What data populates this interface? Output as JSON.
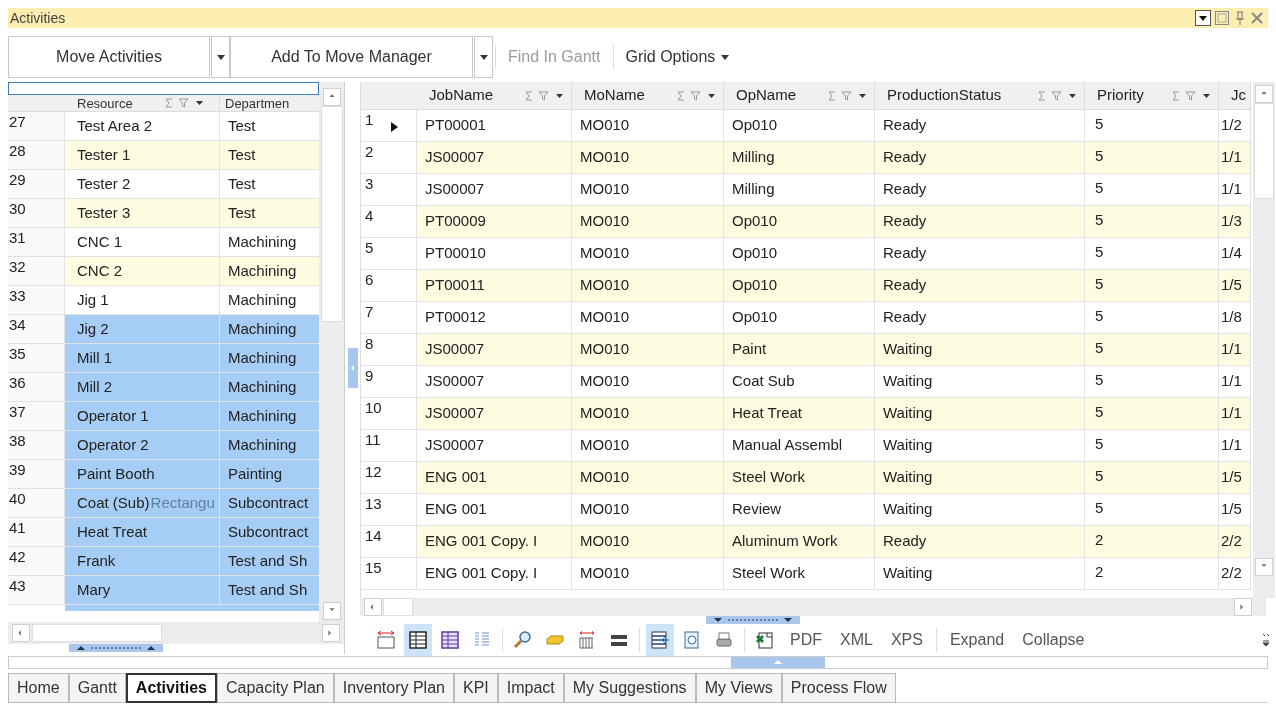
{
  "window": {
    "title": "Activities"
  },
  "toolbar": {
    "items": [
      {
        "kind": "split",
        "label": "Move Activities",
        "disabled": false
      },
      {
        "kind": "split",
        "label": "Add To Move Manager",
        "disabled": false
      },
      {
        "kind": "button",
        "label": "Find In Gantt",
        "disabled": true
      },
      {
        "kind": "menu",
        "label": "Grid Options",
        "disabled": false
      }
    ]
  },
  "resource_grid": {
    "columns": [
      "Resource",
      "Departmen"
    ],
    "rows": [
      {
        "number": "27",
        "resource": "Test Area 2",
        "department": "Test",
        "selected": false
      },
      {
        "number": "28",
        "resource": "Tester 1",
        "department": "Test",
        "selected": false
      },
      {
        "number": "29",
        "resource": "Tester 2",
        "department": "Test",
        "selected": false
      },
      {
        "number": "30",
        "resource": "Tester 3",
        "department": "Test",
        "selected": false
      },
      {
        "number": "31",
        "resource": "CNC 1",
        "department": "Machining",
        "selected": false
      },
      {
        "number": "32",
        "resource": "CNC 2",
        "department": "Machining",
        "selected": false
      },
      {
        "number": "33",
        "resource": "Jig 1",
        "department": "Machining",
        "selected": false
      },
      {
        "number": "34",
        "resource": "Jig 2",
        "department": "Machining",
        "selected": true
      },
      {
        "number": "35",
        "resource": "Mill 1",
        "department": "Machining",
        "selected": true
      },
      {
        "number": "36",
        "resource": "Mill 2",
        "department": "Machining",
        "selected": true
      },
      {
        "number": "37",
        "resource": "Operator 1",
        "department": "Machining",
        "selected": true
      },
      {
        "number": "38",
        "resource": "Operator 2",
        "department": "Machining",
        "selected": true
      },
      {
        "number": "39",
        "resource": "Paint Booth",
        "department": "Painting",
        "selected": true
      },
      {
        "number": "40",
        "resource": "Coat (Sub)",
        "ghost_text": "Rectangu",
        "department": "Subcontract",
        "selected": true
      },
      {
        "number": "41",
        "resource": "Heat Treat",
        "department": "Subcontract",
        "selected": true
      },
      {
        "number": "42",
        "resource": "Frank",
        "department": "Test and Sh",
        "selected": true
      },
      {
        "number": "43",
        "resource": "Mary",
        "department": "Test and Sh",
        "selected": true
      }
    ]
  },
  "activity_grid": {
    "columns": [
      "JobName",
      "MoName",
      "OpName",
      "ProductionStatus",
      "Priority",
      "Jc"
    ],
    "rows": [
      {
        "number": "1",
        "current": true,
        "cells": [
          "PT00001",
          "MO010",
          "Op010",
          "Ready",
          "5",
          "1/2"
        ]
      },
      {
        "number": "2",
        "current": false,
        "cells": [
          "JS00007",
          "MO010",
          "Milling",
          "Ready",
          "5",
          "1/1"
        ]
      },
      {
        "number": "3",
        "current": false,
        "cells": [
          "JS00007",
          "MO010",
          "Milling",
          "Ready",
          "5",
          "1/1"
        ]
      },
      {
        "number": "4",
        "current": false,
        "cells": [
          "PT00009",
          "MO010",
          "Op010",
          "Ready",
          "5",
          "1/3"
        ]
      },
      {
        "number": "5",
        "current": false,
        "cells": [
          "PT00010",
          "MO010",
          "Op010",
          "Ready",
          "5",
          "1/4"
        ]
      },
      {
        "number": "6",
        "current": false,
        "cells": [
          "PT00011",
          "MO010",
          "Op010",
          "Ready",
          "5",
          "1/5"
        ]
      },
      {
        "number": "7",
        "current": false,
        "cells": [
          "PT00012",
          "MO010",
          "Op010",
          "Ready",
          "5",
          "1/8"
        ]
      },
      {
        "number": "8",
        "current": false,
        "cells": [
          "JS00007",
          "MO010",
          "Paint",
          "Waiting",
          "5",
          "1/1"
        ]
      },
      {
        "number": "9",
        "current": false,
        "cells": [
          "JS00007",
          "MO010",
          "Coat Sub",
          "Waiting",
          "5",
          "1/1"
        ]
      },
      {
        "number": "10",
        "current": false,
        "cells": [
          "JS00007",
          "MO010",
          "Heat Treat",
          "Waiting",
          "5",
          "1/1"
        ]
      },
      {
        "number": "11",
        "current": false,
        "cells": [
          "JS00007",
          "MO010",
          "Manual Assembl",
          "Waiting",
          "5",
          "1/1"
        ]
      },
      {
        "number": "12",
        "current": false,
        "cells": [
          "ENG 001",
          "MO010",
          "Steel Work",
          "Waiting",
          "5",
          "1/5"
        ]
      },
      {
        "number": "13",
        "current": false,
        "cells": [
          "ENG 001",
          "MO010",
          "Review",
          "Waiting",
          "5",
          "1/5"
        ]
      },
      {
        "number": "14",
        "current": false,
        "cells": [
          "ENG 001 Copy. I",
          "MO010",
          "Aluminum Work",
          "Ready",
          "2",
          "2/2"
        ]
      },
      {
        "number": "15",
        "current": false,
        "cells": [
          "ENG 001 Copy. I",
          "MO010",
          "Steel Work",
          "Waiting",
          "2",
          "2/2"
        ]
      }
    ]
  },
  "grid_toolbar": {
    "icon_buttons": [
      {
        "pressed": false
      },
      {
        "pressed": true
      },
      {
        "pressed": false
      },
      {
        "pressed": false
      },
      {
        "pressed": false
      },
      {
        "pressed": false
      },
      {
        "pressed": false
      },
      {
        "pressed": false
      },
      {
        "pressed": true
      },
      {
        "pressed": false
      },
      {
        "pressed": false
      },
      {
        "pressed": false
      }
    ],
    "text_buttons": [
      "PDF",
      "XML",
      "XPS",
      "Expand",
      "Collapse"
    ]
  },
  "tabs": [
    {
      "label": "Home",
      "selected": false
    },
    {
      "label": "Gantt",
      "selected": false
    },
    {
      "label": "Activities",
      "selected": true
    },
    {
      "label": "Capacity Plan",
      "selected": false
    },
    {
      "label": "Inventory Plan",
      "selected": false
    },
    {
      "label": "KPI",
      "selected": false
    },
    {
      "label": "Impact",
      "selected": false
    },
    {
      "label": "My Suggestions",
      "selected": false
    },
    {
      "label": "My Views",
      "selected": false
    },
    {
      "label": "Process Flow",
      "selected": false
    }
  ]
}
